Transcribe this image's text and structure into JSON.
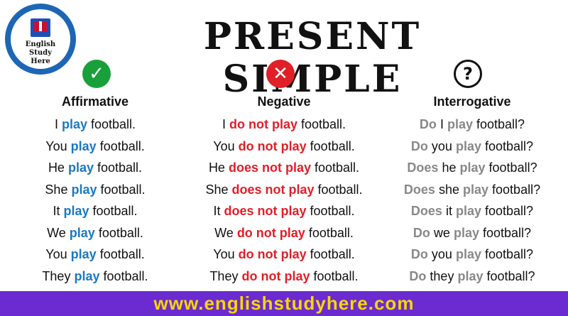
{
  "title": "PRESENT SIMPLE",
  "logo": {
    "line1": "English Study",
    "line2": "Here"
  },
  "icons": {
    "check": "✓",
    "cross": "✕",
    "question": "?"
  },
  "colors": {
    "verb_affirmative": "#1a78c2",
    "verb_negative": "#e01f26",
    "verb_interrogative": "#888888",
    "footer_bg": "#6b2bd0",
    "footer_text": "#f8d700"
  },
  "columns": {
    "affirmative": {
      "heading": "Affirmative",
      "rows": [
        {
          "subject": "I",
          "verb": "play",
          "rest": "football."
        },
        {
          "subject": "You",
          "verb": "play",
          "rest": "football."
        },
        {
          "subject": "He",
          "verb": "play",
          "rest": "football."
        },
        {
          "subject": "She",
          "verb": "play",
          "rest": "football."
        },
        {
          "subject": "It",
          "verb": "play",
          "rest": "football."
        },
        {
          "subject": "We",
          "verb": "play",
          "rest": "football."
        },
        {
          "subject": "You",
          "verb": "play",
          "rest": "football."
        },
        {
          "subject": "They",
          "verb": "play",
          "rest": "football."
        }
      ]
    },
    "negative": {
      "heading": "Negative",
      "rows": [
        {
          "subject": "I",
          "verb": "do not play",
          "rest": "football."
        },
        {
          "subject": "You",
          "verb": "do not play",
          "rest": "football."
        },
        {
          "subject": "He",
          "verb": "does not play",
          "rest": "football."
        },
        {
          "subject": "She",
          "verb": "does not play",
          "rest": "football."
        },
        {
          "subject": "It",
          "verb": "does not play",
          "rest": "football."
        },
        {
          "subject": "We",
          "verb": "do not play",
          "rest": "football."
        },
        {
          "subject": "You",
          "verb": "do not play",
          "rest": "football."
        },
        {
          "subject": "They",
          "verb": "do not play",
          "rest": "football."
        }
      ]
    },
    "interrogative": {
      "heading": "Interrogative",
      "rows": [
        {
          "aux": "Do",
          "subject": "I",
          "verb": "play",
          "rest": "football?"
        },
        {
          "aux": "Do",
          "subject": "you",
          "verb": "play",
          "rest": "football?"
        },
        {
          "aux": "Does",
          "subject": "he",
          "verb": "play",
          "rest": "football?"
        },
        {
          "aux": "Does",
          "subject": "she",
          "verb": "play",
          "rest": "football?"
        },
        {
          "aux": "Does",
          "subject": "it",
          "verb": "play",
          "rest": "football?"
        },
        {
          "aux": "Do",
          "subject": "we",
          "verb": "play",
          "rest": "football?"
        },
        {
          "aux": "Do",
          "subject": "you",
          "verb": "play",
          "rest": "football?"
        },
        {
          "aux": "Do",
          "subject": "they",
          "verb": "play",
          "rest": "football?"
        }
      ]
    }
  },
  "footer": {
    "url": "www.englishstudyhere.com"
  }
}
